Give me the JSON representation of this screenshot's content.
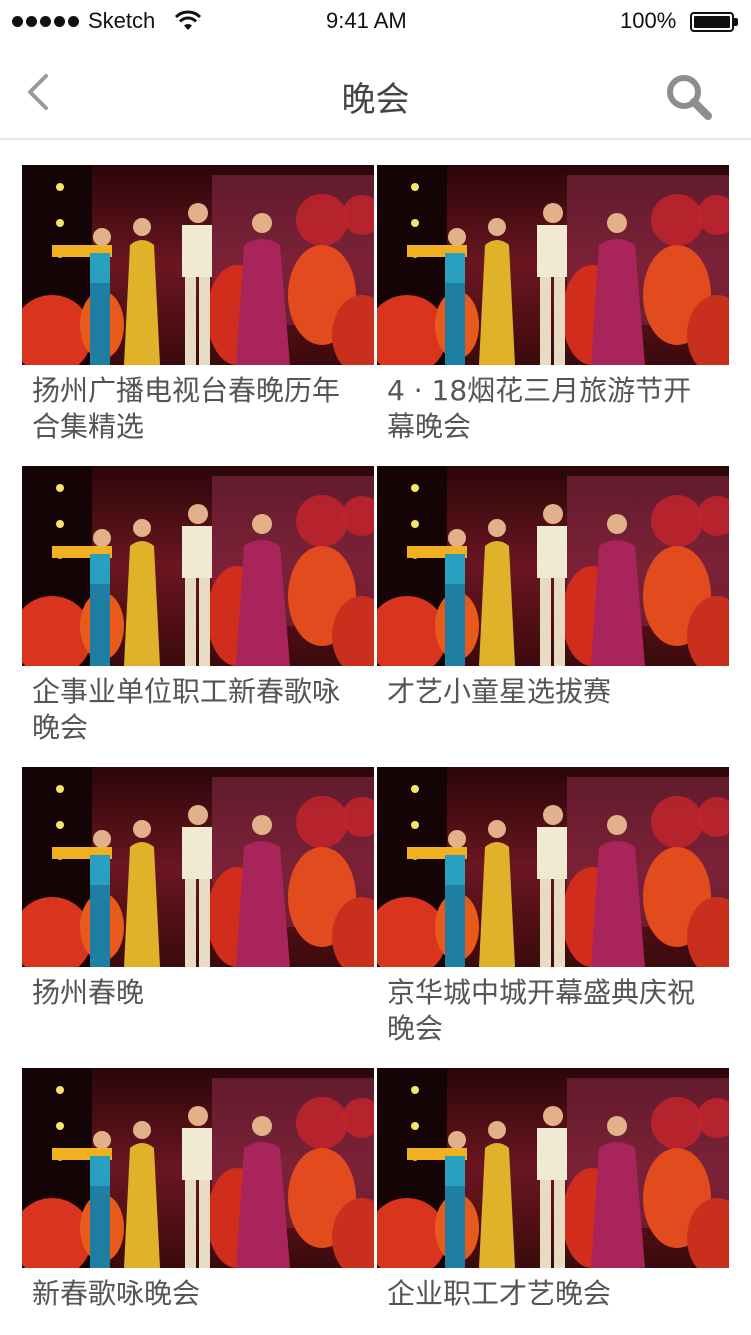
{
  "status_bar": {
    "carrier": "Sketch",
    "time": "9:41 AM",
    "battery_percent": "100%"
  },
  "nav": {
    "title": "晚会",
    "back_icon": "chevron-left-icon",
    "search_icon": "search-icon"
  },
  "items": [
    {
      "title": "扬州广播电视台春晚历年合集精选"
    },
    {
      "title": "4 · 18烟花三月旅游节开幕晚会"
    },
    {
      "title": "企事业单位职工新春歌咏晚会"
    },
    {
      "title": "才艺小童星选拔赛"
    },
    {
      "title": "扬州春晚"
    },
    {
      "title": "京华城中城开幕盛典庆祝晚会"
    },
    {
      "title": "新春歌咏晚会"
    },
    {
      "title": "企业职工才艺晚会"
    }
  ]
}
